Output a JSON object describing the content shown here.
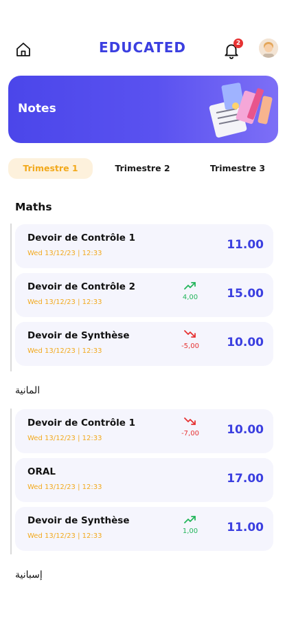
{
  "header": {
    "brand": "EDUCATED",
    "notification_count": "2"
  },
  "banner": {
    "title": "Notes"
  },
  "tabs": [
    {
      "label": "Trimestre 1",
      "active": true
    },
    {
      "label": "Trimestre 2",
      "active": false
    },
    {
      "label": "Trimestre 3",
      "active": false
    }
  ],
  "sections": [
    {
      "title": "Maths",
      "items": [
        {
          "title": "Devoir de Contrôle 1",
          "date": "Wed 13/12/23 | 12:33",
          "grade": "11.00",
          "trend": null
        },
        {
          "title": "Devoir de Contrôle 2",
          "date": "Wed 13/12/23 | 12:33",
          "grade": "15.00",
          "trend": {
            "direction": "up",
            "value": "4,00"
          }
        },
        {
          "title": "Devoir de Synthèse",
          "date": "Wed 13/12/23 | 12:33",
          "grade": "10.00",
          "trend": {
            "direction": "down",
            "value": "-5,00"
          }
        }
      ]
    },
    {
      "title": "المانية",
      "items": [
        {
          "title": "Devoir de Contrôle 1",
          "date": "Wed 13/12/23 | 12:33",
          "grade": "10.00",
          "trend": {
            "direction": "down",
            "value": "-7,00"
          }
        },
        {
          "title": "ORAL",
          "date": "Wed 13/12/23 | 12:33",
          "grade": "17.00",
          "trend": null
        },
        {
          "title": "Devoir de Synthèse",
          "date": "Wed 13/12/23 | 12:33",
          "grade": "11.00",
          "trend": {
            "direction": "up",
            "value": "1,00"
          }
        }
      ]
    },
    {
      "title": "إسبانية",
      "items": []
    }
  ],
  "colors": {
    "accent": "#3b3fe0",
    "date": "#f2a91c",
    "up": "#22b55a",
    "down": "#e63232"
  },
  "icons": {
    "home": "home-icon",
    "bell": "bell-icon",
    "trend_up": "trend-up-icon",
    "trend_down": "trend-down-icon"
  }
}
